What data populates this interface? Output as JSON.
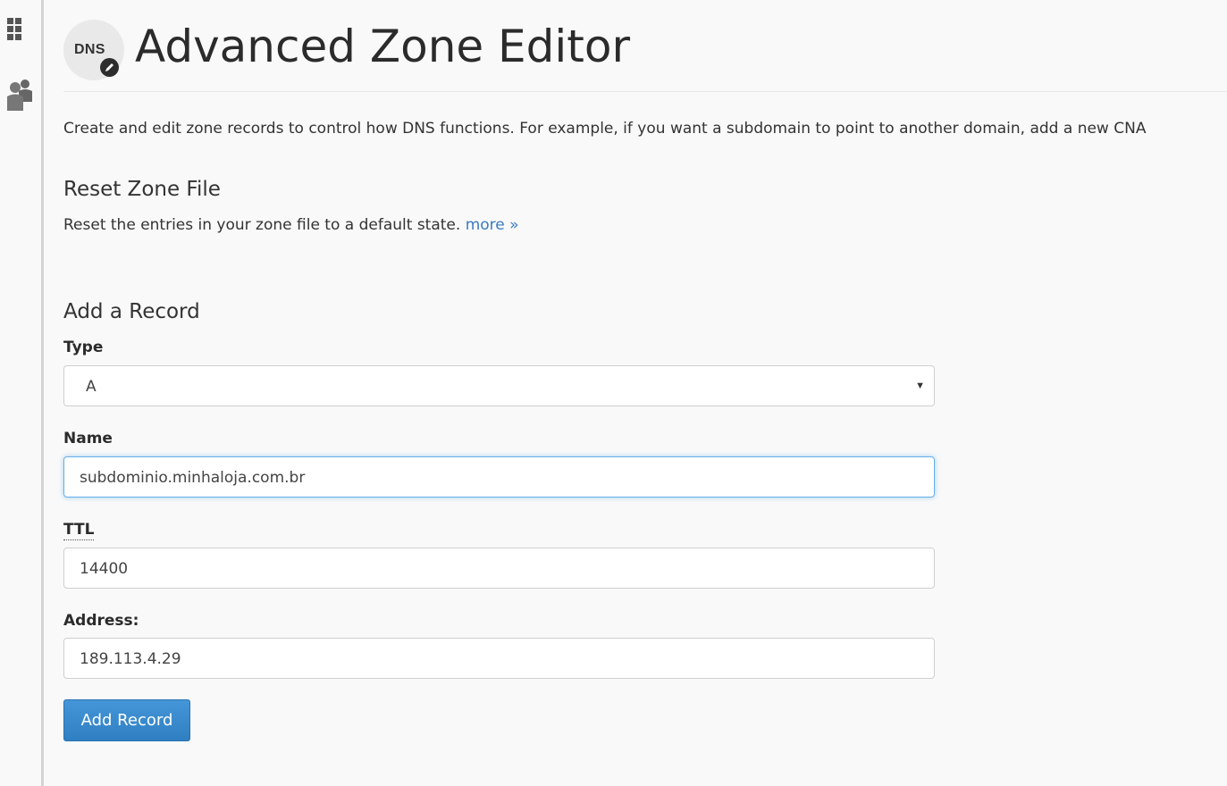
{
  "header": {
    "badge_text": "DNS",
    "title": "Advanced Zone Editor"
  },
  "description": "Create and edit zone records to control how DNS functions. For example, if you want a subdomain to point to another domain, add a new CNA",
  "reset_section": {
    "heading": "Reset Zone File",
    "text": "Reset the entries in your zone file to a default state.",
    "link": "more »"
  },
  "add_record": {
    "heading": "Add a Record",
    "type_label": "Type",
    "type_value": "A",
    "name_label": "Name",
    "name_value": "subdominio.minhaloja.com.br",
    "ttl_label": "TTL",
    "ttl_value": "14400",
    "address_label": "Address:",
    "address_value": "189.113.4.29",
    "button_label": "Add Record"
  },
  "sidebar": {
    "icons": [
      "grid-icon",
      "users-icon"
    ]
  },
  "colors": {
    "accent": "#3b8dd0",
    "link": "#3a7bc0",
    "focus": "#66afe9"
  }
}
